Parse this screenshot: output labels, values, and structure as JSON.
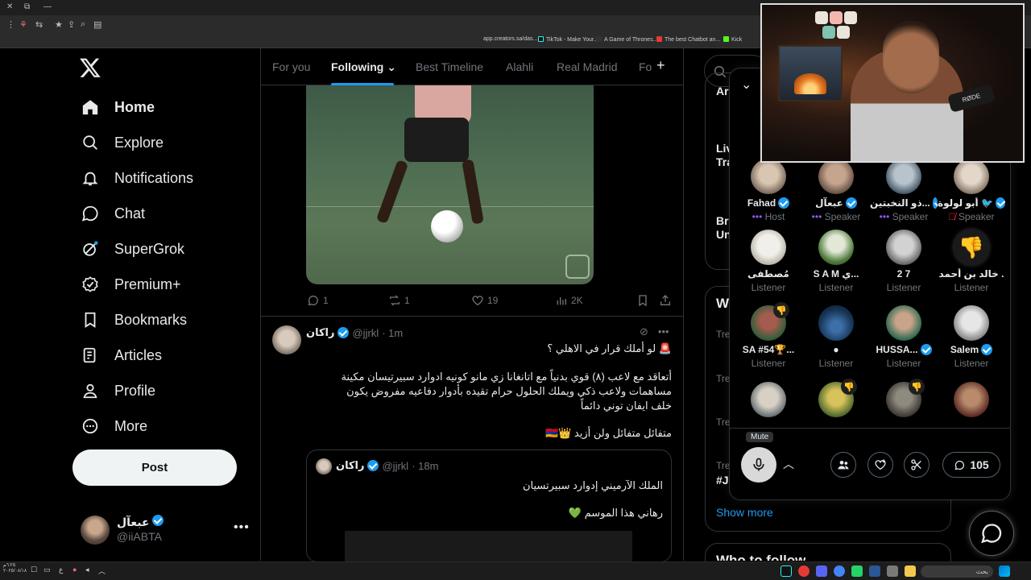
{
  "browser": {
    "bookmarks": [
      "app.creators.sa/das...",
      "TikTok - Make Your...",
      "A Game of Thrones...",
      "The best Chatbot an...",
      "Kick"
    ]
  },
  "nav": {
    "items": [
      {
        "label": "Home",
        "icon": "home-icon",
        "active": true
      },
      {
        "label": "Explore",
        "icon": "search-icon"
      },
      {
        "label": "Notifications",
        "icon": "bell-icon"
      },
      {
        "label": "Chat",
        "icon": "chat-icon"
      },
      {
        "label": "SuperGrok",
        "icon": "grok-icon"
      },
      {
        "label": "Premium+",
        "icon": "premium-icon"
      },
      {
        "label": "Bookmarks",
        "icon": "bookmark-icon"
      },
      {
        "label": "Articles",
        "icon": "articles-icon"
      },
      {
        "label": "Profile",
        "icon": "profile-icon"
      },
      {
        "label": "More",
        "icon": "more-icon"
      }
    ],
    "post_label": "Post",
    "account": {
      "name": "عبعآل",
      "handle": "@iiABTA"
    }
  },
  "timeline": {
    "tabs": [
      "For you",
      "Following",
      "Best Timeline",
      "Alahli",
      "Real Madrid",
      "Fo"
    ],
    "active_tab": "Following",
    "tweet1": {
      "replies": "1",
      "reposts": "1",
      "likes": "19",
      "views": "2K"
    },
    "tweet2": {
      "name": "راكان",
      "handle": "@jjrkl",
      "time": "· 1m",
      "line1": "🚨 لو أملك قرار في الاهلي ؟",
      "para": "أتعاقد مع لاعب (٨) قوي بدنياً مع اتانغانا زي مانو كونيه ادوارد سبيرتيسان مكينة مساهمات ولاعب ذكي ويملك الحلول حرام تقيده بأدوار دفاعيه مفروض يكون خلف ايفان توني دائماً",
      "line3": "متفائل متفائل ولن أزيد 👑🇦🇲",
      "quote": {
        "name": "راكان",
        "handle": "@jjrkl",
        "time": "· 18m",
        "line1": "الملك الآرميني إدوارد سبيرتسيان",
        "line2": "رهاني هذا الموسم 💚"
      }
    }
  },
  "right": {
    "side_labels": [
      "Tre",
      "Tre",
      "Tre",
      "Tre"
    ],
    "partial_text": [
      "Ar",
      "Liv",
      "Tra",
      "Bri",
      "Un",
      "W",
      "#J"
    ],
    "show_more": "Show more",
    "who_to_follow": "Who to follow"
  },
  "space": {
    "participants": [
      {
        "name": "Fahad",
        "verified": true,
        "role": "Host",
        "dots": true
      },
      {
        "name": "عبعآل",
        "verified": true,
        "role": "Speaker",
        "dots": true
      },
      {
        "name": "ذو النخبتين...",
        "verified": true,
        "role": "Speaker",
        "dots": true
      },
      {
        "name": "أبو لولوة 🐦",
        "verified": true,
        "role": "Speaker",
        "muted": true
      },
      {
        "name": "مُصطفى",
        "role": "Listener"
      },
      {
        "name": "S A M ي...",
        "role": "Listener"
      },
      {
        "name": "2 7",
        "role": "Listener"
      },
      {
        "name": "خالد بن أحمد .",
        "role": "Listener"
      },
      {
        "name": "SA #54🏆...",
        "role": "Listener"
      },
      {
        "name": "●",
        "role": "Listener"
      },
      {
        "name": "HUSSA...",
        "verified": true,
        "role": "Listener"
      },
      {
        "name": "Salem",
        "verified": true,
        "role": "Listener"
      }
    ],
    "mute_tooltip": "Mute",
    "reply_count": "105"
  },
  "webcam": {
    "mic_brand": "RØDE"
  },
  "taskbar": {
    "clock_time": "٦:٢٥م",
    "clock_date": "٢٠٢٥/٠٨/١٨",
    "lang": "ع",
    "search_placeholder": "بحث"
  }
}
